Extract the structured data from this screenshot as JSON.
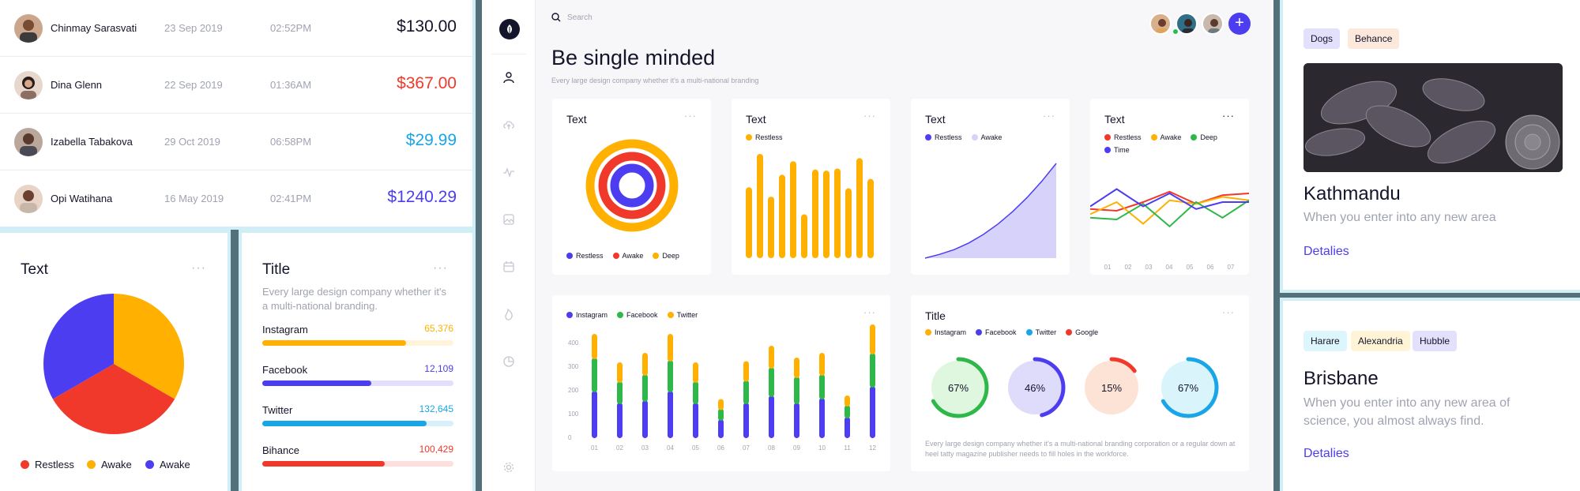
{
  "transactions": [
    {
      "name": "Chinmay Sarasvati",
      "date": "23 Sep 2019",
      "time": "02:52PM",
      "amount": "$130.00",
      "amount_color": "#14142b"
    },
    {
      "name": "Dina Glenn",
      "date": "22 Sep 2019",
      "time": "01:36AM",
      "amount": "$367.00",
      "amount_color": "#f0392b"
    },
    {
      "name": "Izabella Tabakova",
      "date": "29 Oct 2019",
      "time": "06:58PM",
      "amount": "$29.99",
      "amount_color": "#1aa5e6"
    },
    {
      "name": "Opi Watihana",
      "date": "16 May 2019",
      "time": "02:41PM",
      "amount": "$1240.29",
      "amount_color": "#4c3df0"
    }
  ],
  "pie_card": {
    "title": "Text",
    "menu": "···",
    "legend": [
      "Restless",
      "Awake",
      "Awake"
    ],
    "colors": [
      "#f0392b",
      "#ffb000",
      "#4c3df0"
    ],
    "chart_data": {
      "type": "pie",
      "labels": [
        "Restless",
        "Awake",
        "Awake"
      ],
      "values": [
        33.3,
        33.3,
        33.3
      ]
    }
  },
  "social_card": {
    "title": "Title",
    "menu": "···",
    "description": "Every large design company whether it's a multi-national branding.",
    "items": [
      {
        "label": "Instagram",
        "value": "65,376",
        "fraction": 0.75,
        "color": "#ffb000",
        "track": "#fff3d9"
      },
      {
        "label": "Facebook",
        "value": "12,109",
        "fraction": 0.57,
        "color": "#4c3df0",
        "track": "#e2defc"
      },
      {
        "label": "Twitter",
        "value": "132,645",
        "fraction": 0.86,
        "color": "#1aa5e6",
        "track": "#d8f0fb"
      },
      {
        "label": "Bihance",
        "value": "100,429",
        "fraction": 0.64,
        "color": "#f0392b",
        "track": "#fde0dd"
      }
    ]
  },
  "dashboard": {
    "search_placeholder": "Search",
    "title": "Be single minded",
    "subtitle": "Every large design company whether it's a multi-national branding",
    "add_label": "+",
    "card_menu": "···",
    "target_card": {
      "title": "Text",
      "legend": [
        "Restless",
        "Awake",
        "Deep"
      ],
      "colors": [
        "#4c3df0",
        "#f0392b",
        "#ffb000"
      ]
    },
    "bars_card": {
      "title": "Text",
      "legend": [
        "Restless"
      ],
      "color": "#ffb000",
      "chart_data": {
        "type": "bar",
        "series": [
          {
            "name": "Restless",
            "values": [
              68,
              100,
              59,
              80,
              93,
              42,
              85,
              84,
              86,
              67,
              96,
              76
            ]
          }
        ]
      }
    },
    "area_card": {
      "title": "Text",
      "legend": [
        "Restless",
        "Awake"
      ],
      "colors": [
        "#4c3df0",
        "#d6d2fa"
      ],
      "chart_data": {
        "type": "area",
        "series": [
          {
            "name": "Restless",
            "values": [
              0,
              4,
              9,
              16,
              25,
              36,
              49,
              64,
              81,
              100
            ]
          }
        ]
      }
    },
    "lines_card": {
      "title": "Text",
      "legend": [
        "Restless",
        "Awake",
        "Deep",
        "Time"
      ],
      "colors": [
        "#f0392b",
        "#ffb000",
        "#2fb84a",
        "#4c3df0"
      ],
      "chart_data": {
        "type": "line",
        "x": [
          "01",
          "02",
          "03",
          "04",
          "05",
          "06",
          "07"
        ],
        "series": [
          {
            "name": "Restless",
            "values": [
              62,
              60,
              70,
              82,
              68,
              78,
              80
            ]
          },
          {
            "name": "Awake",
            "values": [
              56,
              70,
              45,
              72,
              68,
              76,
              72
            ]
          },
          {
            "name": "Deep",
            "values": [
              52,
              50,
              68,
              42,
              70,
              52,
              72
            ]
          },
          {
            "name": "Time",
            "values": [
              65,
              85,
              65,
              80,
              62,
              70,
              70
            ]
          }
        ]
      }
    },
    "stacked_card": {
      "legend": [
        "Instagram",
        "Facebook",
        "Twitter"
      ],
      "colors": [
        "#4c3df0",
        "#2fb84a",
        "#ffb000"
      ],
      "chart_data": {
        "type": "bar",
        "stacked": true,
        "categories": [
          "01",
          "02",
          "03",
          "04",
          "05",
          "06",
          "07",
          "08",
          "09",
          "10",
          "11",
          "12"
        ],
        "yticks": [
          "400",
          "300",
          "200",
          "100",
          "0"
        ],
        "ylim": [
          0,
          450
        ],
        "series": [
          {
            "name": "Instagram",
            "values": [
              200,
              150,
              160,
              200,
              150,
              80,
              150,
              180,
              150,
              170,
              90,
              220
            ]
          },
          {
            "name": "Facebook",
            "values": [
              140,
              90,
              110,
              130,
              90,
              45,
              95,
              120,
              110,
              100,
              50,
              140
            ]
          },
          {
            "name": "Twitter",
            "values": [
              100,
              80,
              90,
              110,
              80,
              40,
              80,
              90,
              80,
              90,
              40,
              120
            ]
          }
        ]
      }
    },
    "donuts_card": {
      "title": "Title",
      "legend": [
        "Instagram",
        "Facebook",
        "Twitter",
        "Google"
      ],
      "legend_colors": [
        "#ffb000",
        "#4c3df0",
        "#1aa5e6",
        "#f0392b"
      ],
      "donuts": [
        {
          "pct": "67%",
          "fraction": 0.67,
          "color": "#2fb84a",
          "bg": "#def7de"
        },
        {
          "pct": "46%",
          "fraction": 0.46,
          "color": "#4c3df0",
          "bg": "#dedbfb"
        },
        {
          "pct": "15%",
          "fraction": 0.15,
          "color": "#f0392b",
          "bg": "#fde3d6"
        },
        {
          "pct": "67%",
          "fraction": 0.67,
          "color": "#1aa5e6",
          "bg": "#d9f5fb"
        }
      ],
      "description": "Every large design company whether it's a multi-national branding corporation or a regular down at heel tatty magazine publisher needs to fill holes in the workforce."
    }
  },
  "cities": [
    {
      "tags": [
        {
          "label": "Dogs",
          "bg": "#e3e0fc"
        },
        {
          "label": "Behance",
          "bg": "#fde9dc"
        }
      ],
      "name": "Kathmandu",
      "description": "When you enter into any new area",
      "link": "Detalies"
    },
    {
      "tags": [
        {
          "label": "Harare",
          "bg": "#dcf6fb"
        },
        {
          "label": "Alexandria",
          "bg": "#fff4d6"
        },
        {
          "label": "Hubble",
          "bg": "#e3e0fc"
        }
      ],
      "name": "Brisbane",
      "description": "When you enter into any new area of science, you almost always find.",
      "link": "Detalies"
    }
  ]
}
